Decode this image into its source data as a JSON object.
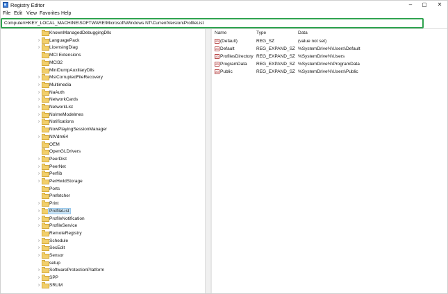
{
  "window": {
    "title": "Registry Editor",
    "controls": {
      "minimize": "–",
      "maximize": "▢",
      "close": "✕"
    }
  },
  "menu": [
    "File",
    "Edit",
    "View",
    "Favorites",
    "Help"
  ],
  "address": {
    "path": "Computer\\HKEY_LOCAL_MACHINE\\SOFTWARE\\Microsoft\\Windows NT\\CurrentVersion\\ProfileList",
    "highlight_color": "#2fa34f"
  },
  "tree": {
    "expander_glyph": "›",
    "selected": "ProfileList",
    "items": [
      {
        "label": "KnownManagedDebuggingDlls",
        "expandable": false
      },
      {
        "label": "LanguagePack",
        "expandable": true
      },
      {
        "label": "LicensingDiag",
        "expandable": true
      },
      {
        "label": "MCI Extensions",
        "expandable": false
      },
      {
        "label": "MCI32",
        "expandable": false
      },
      {
        "label": "MiniDumpAuxiliaryDlls",
        "expandable": false
      },
      {
        "label": "MsiCorruptedFileRecovery",
        "expandable": true
      },
      {
        "label": "Multimedia",
        "expandable": true
      },
      {
        "label": "NaAuth",
        "expandable": true
      },
      {
        "label": "NetworkCards",
        "expandable": true
      },
      {
        "label": "NetworkList",
        "expandable": true
      },
      {
        "label": "NoImeModelmes",
        "expandable": true
      },
      {
        "label": "Notifications",
        "expandable": true
      },
      {
        "label": "NowPlayingSessionManager",
        "expandable": false
      },
      {
        "label": "NtVdm64",
        "expandable": true
      },
      {
        "label": "OEM",
        "expandable": false
      },
      {
        "label": "OpenGLDrivers",
        "expandable": false
      },
      {
        "label": "PeerDist",
        "expandable": true
      },
      {
        "label": "PeerNet",
        "expandable": true
      },
      {
        "label": "Perflib",
        "expandable": true
      },
      {
        "label": "PerHwIdStorage",
        "expandable": true
      },
      {
        "label": "Ports",
        "expandable": false
      },
      {
        "label": "Prefetcher",
        "expandable": false
      },
      {
        "label": "Print",
        "expandable": true
      },
      {
        "label": "ProfileList",
        "expandable": true
      },
      {
        "label": "ProfileNotification",
        "expandable": true
      },
      {
        "label": "ProfileService",
        "expandable": true
      },
      {
        "label": "RemoteRegistry",
        "expandable": false
      },
      {
        "label": "Schedule",
        "expandable": true
      },
      {
        "label": "SecEdit",
        "expandable": true
      },
      {
        "label": "Sensor",
        "expandable": true
      },
      {
        "label": "setup",
        "expandable": false
      },
      {
        "label": "SoftwareProtectionPlatform",
        "expandable": true
      },
      {
        "label": "SPP",
        "expandable": true
      },
      {
        "label": "SRUM",
        "expandable": true
      }
    ]
  },
  "values": {
    "headers": {
      "name": "Name",
      "type": "Type",
      "data": "Data"
    },
    "icon_glyph": "ab",
    "rows": [
      {
        "name": "(Default)",
        "type": "REG_SZ",
        "data": "(value not set)"
      },
      {
        "name": "Default",
        "type": "REG_EXPAND_SZ",
        "data": "%SystemDrive%\\Users\\Default"
      },
      {
        "name": "ProfilesDirectory",
        "type": "REG_EXPAND_SZ",
        "data": "%SystemDrive%\\Users"
      },
      {
        "name": "ProgramData",
        "type": "REG_EXPAND_SZ",
        "data": "%SystemDrive%\\ProgramData"
      },
      {
        "name": "Public",
        "type": "REG_EXPAND_SZ",
        "data": "%SystemDrive%\\Users\\Public"
      }
    ]
  }
}
